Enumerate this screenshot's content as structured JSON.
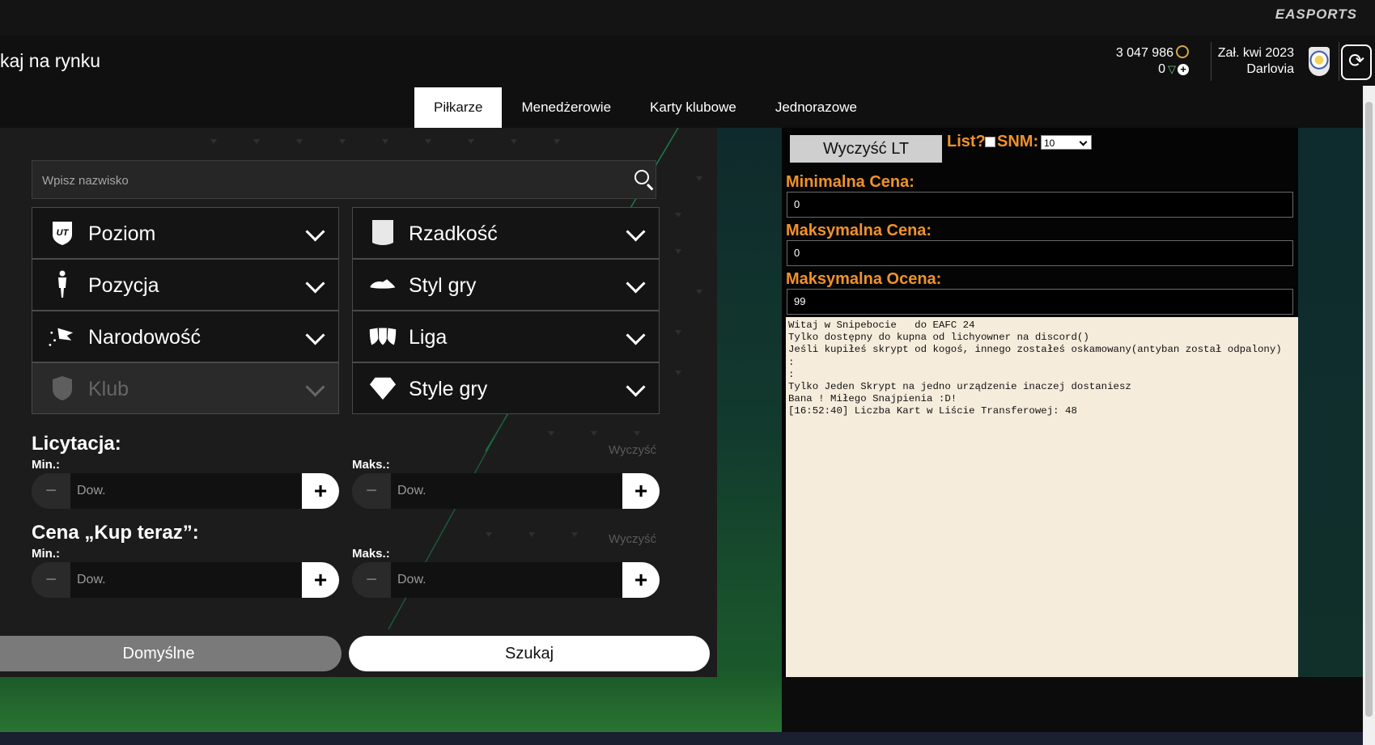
{
  "brand": {
    "logo": "EASPORTS"
  },
  "page": {
    "title": "kaj na rynku"
  },
  "currency": {
    "coins": "3 047 986",
    "points": "0"
  },
  "club": {
    "founded": "Zał. kwi 2023",
    "name": "Darlovia"
  },
  "tabs": [
    {
      "label": "Piłkarze",
      "active": true
    },
    {
      "label": "Menedżerowie",
      "active": false
    },
    {
      "label": "Karty klubowe",
      "active": false
    },
    {
      "label": "Jednorazowe",
      "active": false
    }
  ],
  "search": {
    "placeholder": "Wpisz nazwisko"
  },
  "filters": {
    "level": "Poziom",
    "rarity": "Rzadkość",
    "position": "Pozycja",
    "playstyle": "Styl gry",
    "nationality": "Narodowość",
    "league": "Liga",
    "club": "Klub",
    "playstyles": "Style gry"
  },
  "bid": {
    "title": "Licytacja:",
    "clear": "Wyczyść",
    "min_label": "Min.:",
    "max_label": "Maks.:",
    "placeholder": "Dow."
  },
  "buy_now": {
    "title": "Cena „Kup teraz”:",
    "clear": "Wyczyść",
    "min_label": "Min.:",
    "max_label": "Maks.:",
    "placeholder": "Dow."
  },
  "actions": {
    "default_label": "Domyślne",
    "search_label": "Szukaj"
  },
  "script_panel": {
    "clear_button": "Wyczyść LT",
    "list_label": "List?",
    "snm_label": "SNM:",
    "snm_value": "10",
    "min_price_label": "Minimalna Cena:",
    "min_price_value": "0",
    "max_price_label": "Maksymalna Cena:",
    "max_price_value": "0",
    "max_rating_label": "Maksymalna Ocena:",
    "max_rating_value": "99",
    "log": "Witaj w Snipebocie   do EAFC 24\nTylko dostępny do kupna od lichyowner na discord()\nJeśli kupiłeś skrypt od kogoś, innego zostałeś oskamowany(antyban został odpalony)\n:\n:\nTylko Jeden Skrypt na jedno urządzenie inaczej dostaniesz\nBana ! Miłego Snajpienia :D!\n[16:52:40] Liczba Kart w Liście Transferowej: 48"
  },
  "colors": {
    "accent_orange": "#f0922a",
    "coin_gold": "#d3a84a",
    "points_green": "#6cc38c"
  }
}
